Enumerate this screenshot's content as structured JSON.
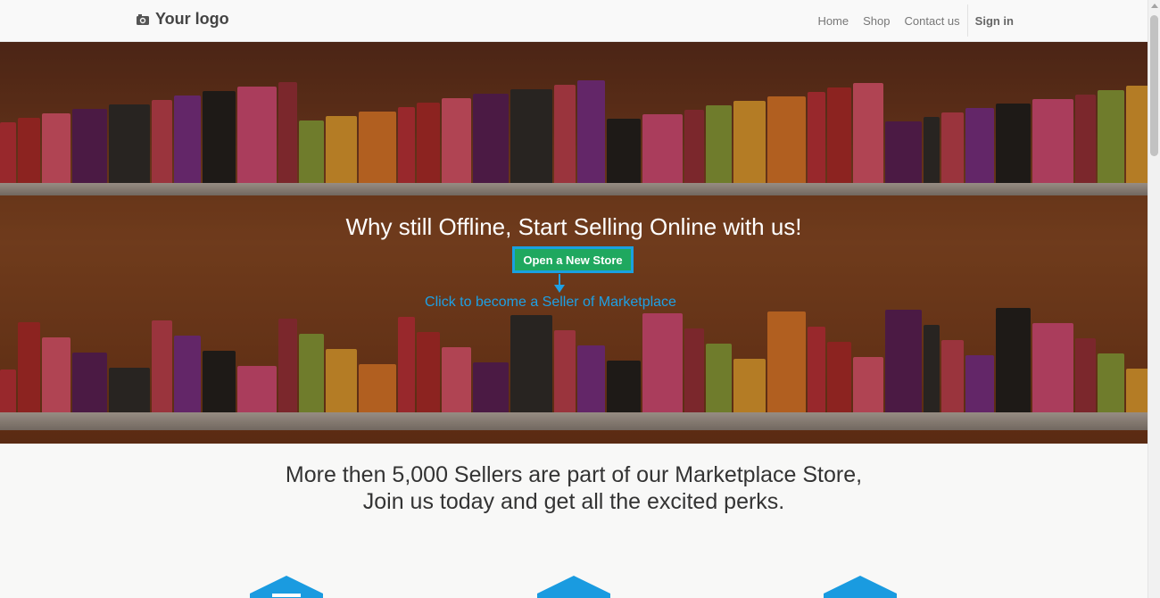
{
  "header": {
    "logo_text": "Your logo",
    "nav": {
      "home": "Home",
      "shop": "Shop",
      "contact": "Contact us",
      "signin": "Sign in"
    }
  },
  "hero": {
    "title": "Why still Offline, Start Selling Online with us!",
    "cta_label": "Open a New Store",
    "subtitle": "Click to become a Seller of Marketplace"
  },
  "content": {
    "tagline_line1": "More then 5,000 Sellers are part of our Marketplace Store,",
    "tagline_line2": "Join us today and get all the excited perks."
  },
  "colors": {
    "accent_blue": "#1ea0e4",
    "cta_green": "#1fa85f",
    "icon_blue": "#1a9be0"
  },
  "icons": {
    "logo": "camera-icon",
    "features": [
      "feature-icon-1",
      "feature-icon-2",
      "feature-icon-3"
    ]
  }
}
